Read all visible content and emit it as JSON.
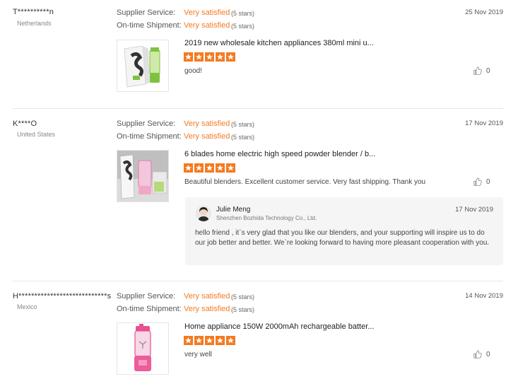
{
  "labels": {
    "supplier_service": "Supplier Service:",
    "on_time_shipment": "On-time Shipment:"
  },
  "reviews": [
    {
      "buyer": "T**********n",
      "country": "Netherlands",
      "date": "25 Nov 2019",
      "supplier_service": "Very satisfied",
      "supplier_stars": "(5 stars)",
      "shipment": "Very satisfied",
      "shipment_stars": "(5 stars)",
      "product_name": "2019 new wholesale kitchen appliances 380ml mini u...",
      "rating": 5,
      "comment": "good!",
      "likes": "0"
    },
    {
      "buyer": "K****O",
      "country": "United States",
      "date": "17 Nov 2019",
      "supplier_service": "Very satisfied",
      "supplier_stars": "(5 stars)",
      "shipment": "Very satisfied",
      "shipment_stars": "(5 stars)",
      "product_name": "6 blades home electric high speed powder blender / b...",
      "rating": 5,
      "comment": "Beautiful blenders. Excellent customer service. Very fast shipping. Thank you",
      "likes": "0",
      "reply": {
        "name": "Julie Meng",
        "company": "Shenzhen Bozhida Technology Co., Ltd.",
        "date": "17 Nov 2019",
        "text": "hello friend , it`s  very glad that you like our blenders, and your supporting will  inspire us to  do our job better and better.  We`re looking forward to having more pleasant cooperation with you."
      }
    },
    {
      "buyer": "H****************************s",
      "country": "Mexico",
      "date": "14 Nov 2019",
      "supplier_service": "Very satisfied",
      "supplier_stars": "(5 stars)",
      "shipment": "Very satisfied",
      "shipment_stars": "(5 stars)",
      "product_name": "Home appliance 150W 2000mAh rechargeable batter...",
      "rating": 5,
      "comment": "very well",
      "likes": "0"
    }
  ],
  "colors": {
    "accent": "#f47a20",
    "star": "#f47a20",
    "divider": "#e6e6e6",
    "reply_bg": "#f5f5f5"
  }
}
